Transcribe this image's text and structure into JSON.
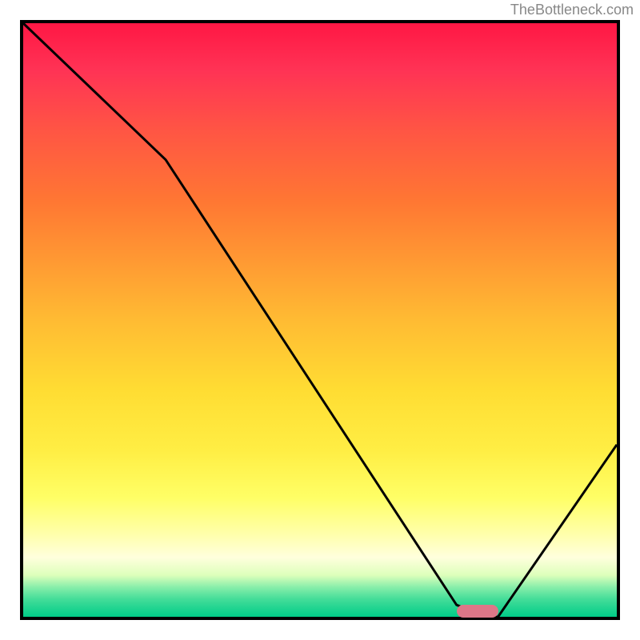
{
  "watermark": "TheBottleneck.com",
  "chart_data": {
    "type": "line",
    "title": "",
    "xlabel": "",
    "ylabel": "",
    "xlim": [
      0,
      100
    ],
    "ylim": [
      0,
      100
    ],
    "series": [
      {
        "name": "curve",
        "x": [
          0,
          24,
          73,
          78,
          80,
          100
        ],
        "y": [
          100,
          77,
          2,
          0,
          0,
          29
        ]
      }
    ],
    "marker": {
      "x_start": 73,
      "x_end": 80,
      "y": 1,
      "color": "#dd7788"
    },
    "gradient_colors": {
      "top": "#ff1744",
      "middle": "#ffdd33",
      "bottom": "#00cc88"
    }
  }
}
